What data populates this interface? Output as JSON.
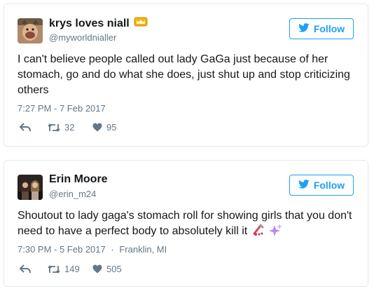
{
  "colors": {
    "accent": "#1da1f2",
    "muted": "#657786",
    "text": "#14171a",
    "border": "#e1e8ed"
  },
  "tweets": [
    {
      "name": "krys loves niall",
      "name_emoji": "crown-emoji",
      "handle": "@myworldnialler",
      "follow_label": "Follow",
      "text": "I can't believe people called out lady GaGa just because of her stomach, go and do what she does, just shut up and stop criticizing others",
      "time": "7:27 PM - 7 Feb 2017",
      "location": "",
      "retweets": "32",
      "likes": "95"
    },
    {
      "name": "Erin Moore",
      "handle": "@erin_m24",
      "follow_label": "Follow",
      "text": "Shoutout to lady gaga's stomach roll for showing girls that you don't need to have a perfect body to absolutely kill it",
      "text_emojis": [
        "nail-polish-emoji",
        "sparkles-emoji"
      ],
      "time": "7:30 PM - 5 Feb 2017",
      "separator": "·",
      "location": "Franklin, MI",
      "retweets": "149",
      "likes": "505"
    }
  ]
}
